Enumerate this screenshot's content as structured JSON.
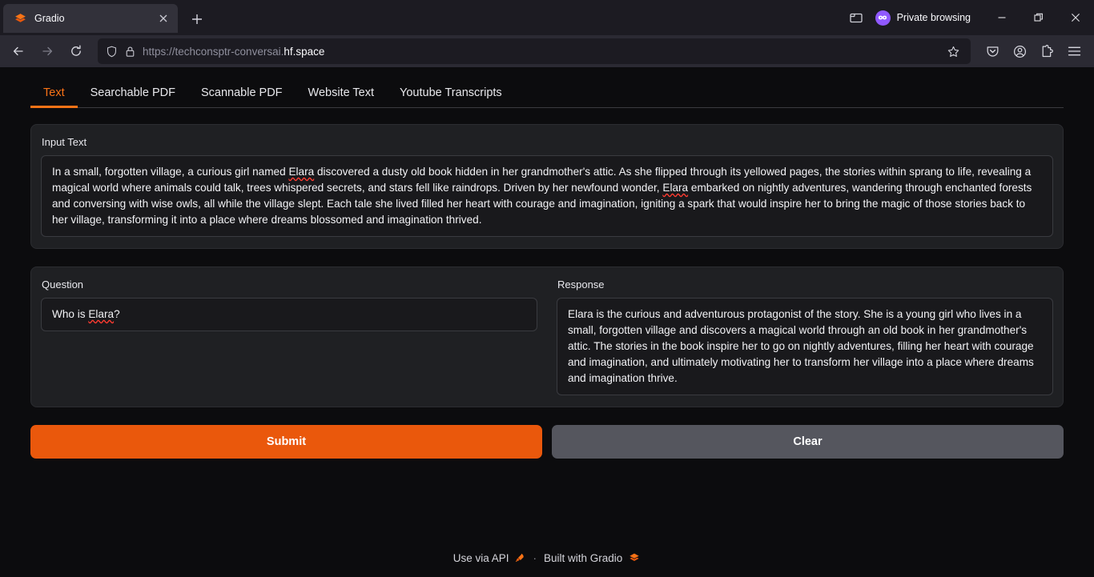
{
  "browser": {
    "tab": {
      "title": "Gradio",
      "favicon": "gradio-logo-icon",
      "close": "close-icon"
    },
    "new_tab": "+",
    "list_all_tabs": "tab-list-icon",
    "private_browsing_label": "Private browsing",
    "window": {
      "minimize": "—",
      "restore": "restore-icon",
      "close": "✕"
    },
    "nav": {
      "back": "←",
      "forward": "→",
      "reload": "⟳"
    },
    "url": {
      "scheme_host": "https://techconsptr-conversai.",
      "domain": "hf.space",
      "full": "https://techconsptr-conversai.hf.space"
    },
    "toolbar_icons": [
      "pocket-icon",
      "account-icon",
      "extensions-icon",
      "app-menu-icon"
    ]
  },
  "app": {
    "tabs": [
      {
        "label": "Text",
        "active": true
      },
      {
        "label": "Searchable PDF",
        "active": false
      },
      {
        "label": "Scannable PDF",
        "active": false
      },
      {
        "label": "Website Text",
        "active": false
      },
      {
        "label": "Youtube Transcripts",
        "active": false
      }
    ],
    "input_panel": {
      "label": "Input Text",
      "value_part1": "In a small, forgotten village, a curious girl named ",
      "misspelled1": "Elara",
      "value_part2": " discovered a dusty old book hidden in her grandmother's attic. As she flipped through its yellowed pages, the stories within sprang to life, revealing a magical world where animals could talk, trees whispered secrets, and stars fell like raindrops. Driven by her newfound wonder, ",
      "misspelled2": "Elara",
      "value_part3": " embarked on nightly adventures, wandering through enchanted forests and conversing with wise owls, all while the village slept. Each tale she lived filled her heart with courage and imagination, igniting a spark that would inspire her to bring the magic of those stories back to her village, transforming it into a place where dreams blossomed and imagination thrived.",
      "full_value": "In a small, forgotten village, a curious girl named Elara discovered a dusty old book hidden in her grandmother's attic. As she flipped through its yellowed pages, the stories within sprang to life, revealing a magical world where animals could talk, trees whispered secrets, and stars fell like raindrops. Driven by her newfound wonder, Elara embarked on nightly adventures, wandering through enchanted forests and conversing with wise owls, all while the village slept. Each tale she lived filled her heart with courage and imagination, igniting a spark that would inspire her to bring the magic of those stories back to her village, transforming it into a place where dreams blossomed and imagination thrived."
    },
    "question_panel": {
      "label": "Question",
      "value_prefix": "Who is ",
      "misspelled": "Elara",
      "value_suffix": "?",
      "full_value": "Who is Elara?"
    },
    "response_panel": {
      "label": "Response",
      "value": "Elara is the curious and adventurous protagonist of the story. She is a young girl who lives in a small, forgotten village and discovers a magical world through an old book in her grandmother's attic. The stories in the book inspire her to go on nightly adventures, filling her heart with courage and imagination, and ultimately motivating her to transform her village into a place where dreams and imagination thrive."
    },
    "buttons": {
      "submit": "Submit",
      "clear": "Clear"
    },
    "footer": {
      "api_label": "Use via API",
      "api_icon": "rocket-icon",
      "separator": "·",
      "built_label": "Built with Gradio",
      "built_icon": "gradio-logo-icon"
    }
  },
  "colors": {
    "accent": "#f97316",
    "submit_button": "#ea580c",
    "clear_button": "#55565e",
    "page_bg": "#0c0c0e",
    "panel_bg": "#1f2023",
    "textbox_bg": "#19191c",
    "private_badge": "#9059ff",
    "spellcheck": "#ff3b30"
  }
}
